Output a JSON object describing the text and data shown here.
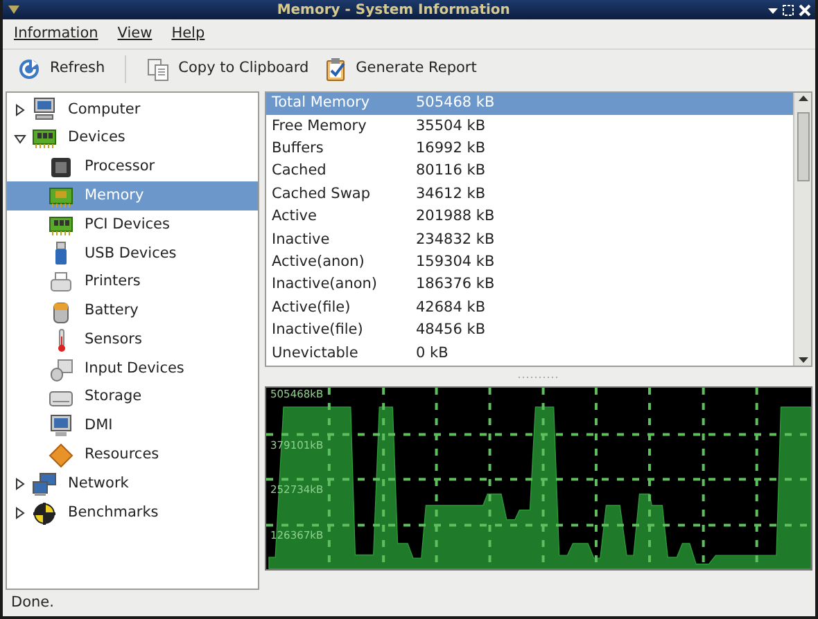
{
  "window": {
    "title": "Memory - System Information"
  },
  "menu": [
    "Information",
    "View",
    "Help"
  ],
  "toolbar": [
    "Refresh",
    "Copy to Clipboard",
    "Generate Report"
  ],
  "tree": [
    {
      "label": "Computer",
      "expanded": false,
      "selected": false
    },
    {
      "label": "Devices",
      "expanded": true,
      "selected": false,
      "children": [
        {
          "label": "Processor",
          "selected": false
        },
        {
          "label": "Memory",
          "selected": true
        },
        {
          "label": "PCI Devices",
          "selected": false
        },
        {
          "label": "USB Devices",
          "selected": false
        },
        {
          "label": "Printers",
          "selected": false
        },
        {
          "label": "Battery",
          "selected": false
        },
        {
          "label": "Sensors",
          "selected": false
        },
        {
          "label": "Input Devices",
          "selected": false
        },
        {
          "label": "Storage",
          "selected": false
        },
        {
          "label": "DMI",
          "selected": false
        },
        {
          "label": "Resources",
          "selected": false
        }
      ]
    },
    {
      "label": "Network",
      "expanded": false,
      "selected": false
    },
    {
      "label": "Benchmarks",
      "expanded": false,
      "selected": false
    }
  ],
  "table": {
    "rows": [
      {
        "name": "Total Memory",
        "value": "505468 kB",
        "selected": true
      },
      {
        "name": "Free Memory",
        "value": "35504 kB",
        "selected": false
      },
      {
        "name": "Buffers",
        "value": "16992 kB",
        "selected": false
      },
      {
        "name": "Cached",
        "value": "80116 kB",
        "selected": false
      },
      {
        "name": "Cached Swap",
        "value": "34612 kB",
        "selected": false
      },
      {
        "name": "Active",
        "value": "201988 kB",
        "selected": false
      },
      {
        "name": "Inactive",
        "value": "234832 kB",
        "selected": false
      },
      {
        "name": "Active(anon)",
        "value": "159304 kB",
        "selected": false
      },
      {
        "name": "Inactive(anon)",
        "value": "186376 kB",
        "selected": false
      },
      {
        "name": "Active(file)",
        "value": "42684 kB",
        "selected": false
      },
      {
        "name": "Inactive(file)",
        "value": "48456 kB",
        "selected": false
      },
      {
        "name": "Unevictable",
        "value": "0 kB",
        "selected": false
      }
    ]
  },
  "graph": {
    "labels": [
      "505468kB",
      "379101kB",
      "252734kB",
      "126367kB"
    ]
  },
  "status_bar": "Done."
}
